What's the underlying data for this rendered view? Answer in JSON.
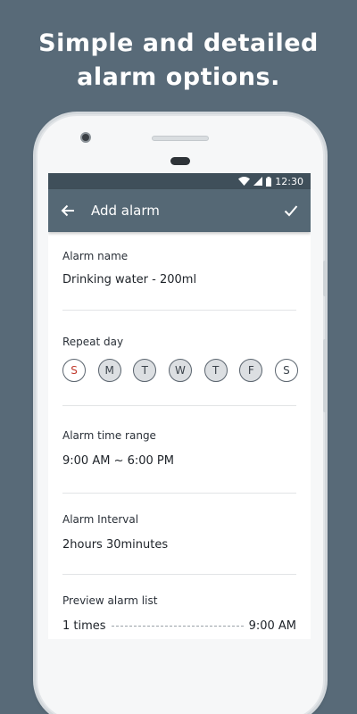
{
  "headline": {
    "line1": "Simple and detailed",
    "line2": "alarm options."
  },
  "status_bar": {
    "time": "12:30",
    "icons": [
      "wifi-icon",
      "signal-icon",
      "battery-icon"
    ]
  },
  "app_bar": {
    "title": "Add alarm",
    "back_icon": "arrow-left-icon",
    "confirm_icon": "check-icon"
  },
  "form": {
    "alarm_name": {
      "label": "Alarm name",
      "value": "Drinking water - 200ml"
    },
    "repeat_day": {
      "label": "Repeat day",
      "days": [
        {
          "letter": "S",
          "selected": false
        },
        {
          "letter": "M",
          "selected": true
        },
        {
          "letter": "T",
          "selected": true
        },
        {
          "letter": "W",
          "selected": true
        },
        {
          "letter": "T",
          "selected": true
        },
        {
          "letter": "F",
          "selected": true
        },
        {
          "letter": "S",
          "selected": false
        }
      ]
    },
    "time_range": {
      "label": "Alarm time range",
      "value": "9:00 AM ~ 6:00 PM"
    },
    "interval": {
      "label": "Alarm Interval",
      "value": "2hours 30minutes"
    },
    "preview": {
      "label": "Preview alarm list",
      "items": [
        {
          "count": "1 times",
          "time": "9:00 AM"
        }
      ]
    }
  },
  "colors": {
    "background": "#586a78",
    "app_bar": "#556875",
    "status_bar": "#3f4f5a",
    "sunday": "#c0392b"
  }
}
